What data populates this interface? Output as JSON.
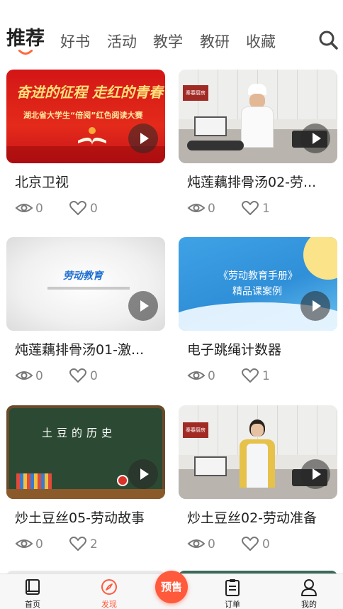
{
  "nav": {
    "tabs": [
      {
        "label": "推荐",
        "active": true
      },
      {
        "label": "好书",
        "active": false
      },
      {
        "label": "活动",
        "active": false
      },
      {
        "label": "教学",
        "active": false
      },
      {
        "label": "教研",
        "active": false
      },
      {
        "label": "收藏",
        "active": false
      }
    ],
    "search_icon": "search-icon",
    "accent_color": "#ff6a3d"
  },
  "cards": [
    {
      "title": "北京卫视",
      "views": "0",
      "likes": "0",
      "thumb_slogan": "奋进的征程 走红的青春",
      "thumb_caption": "湖北省大学生“倍阅”红色阅读大赛"
    },
    {
      "title": "炖莲藕排骨汤02-劳...",
      "views": "0",
      "likes": "1",
      "thumb_sign": "秦春厨房"
    },
    {
      "title": "炖莲藕排骨汤01-激...",
      "views": "0",
      "likes": "0",
      "thumb_caption": "劳动教育"
    },
    {
      "title": "电子跳绳计数器",
      "views": "0",
      "likes": "1",
      "thumb_caption": "《劳动教育手册》",
      "thumb_sub": "精品课案例"
    },
    {
      "title": "炒土豆丝05-劳动故事",
      "views": "0",
      "likes": "2",
      "thumb_caption": "土豆的历史"
    },
    {
      "title": "炒土豆丝02-劳动准备",
      "views": "0",
      "likes": "0",
      "thumb_sign": "秦春厨房"
    }
  ],
  "bottom_nav": {
    "items": [
      {
        "label": "首页",
        "icon": "book-icon",
        "active": false
      },
      {
        "label": "发现",
        "icon": "compass-icon",
        "active": true
      },
      {
        "label": "订单",
        "icon": "clipboard-icon",
        "active": false
      },
      {
        "label": "我的",
        "icon": "person-icon",
        "active": false
      }
    ],
    "presale_label": "预售",
    "active_color": "#ff5a3c"
  }
}
